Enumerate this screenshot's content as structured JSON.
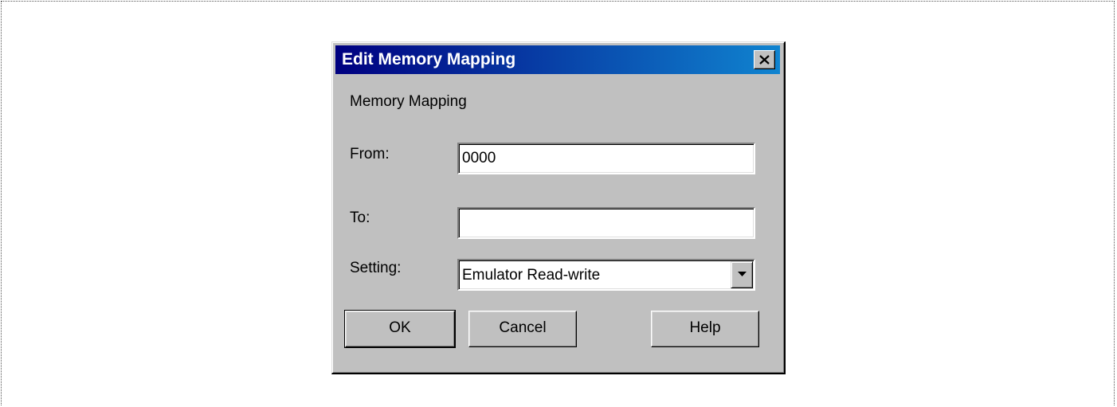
{
  "dialog": {
    "title": "Edit Memory Mapping",
    "close_icon": "close-icon",
    "group_label": "Memory Mapping",
    "from_label": "From:",
    "from_value": "0000",
    "to_label": "To:",
    "to_value": "",
    "setting_label": "Setting:",
    "setting_value": "Emulator Read-write",
    "dropdown_icon": "chevron-down-icon",
    "ok_label": "OK",
    "cancel_label": "Cancel",
    "help_label": "Help"
  },
  "colors": {
    "face": "#c0c0c0",
    "title_start": "#000080",
    "title_end": "#1084d0",
    "title_text": "#ffffff"
  }
}
